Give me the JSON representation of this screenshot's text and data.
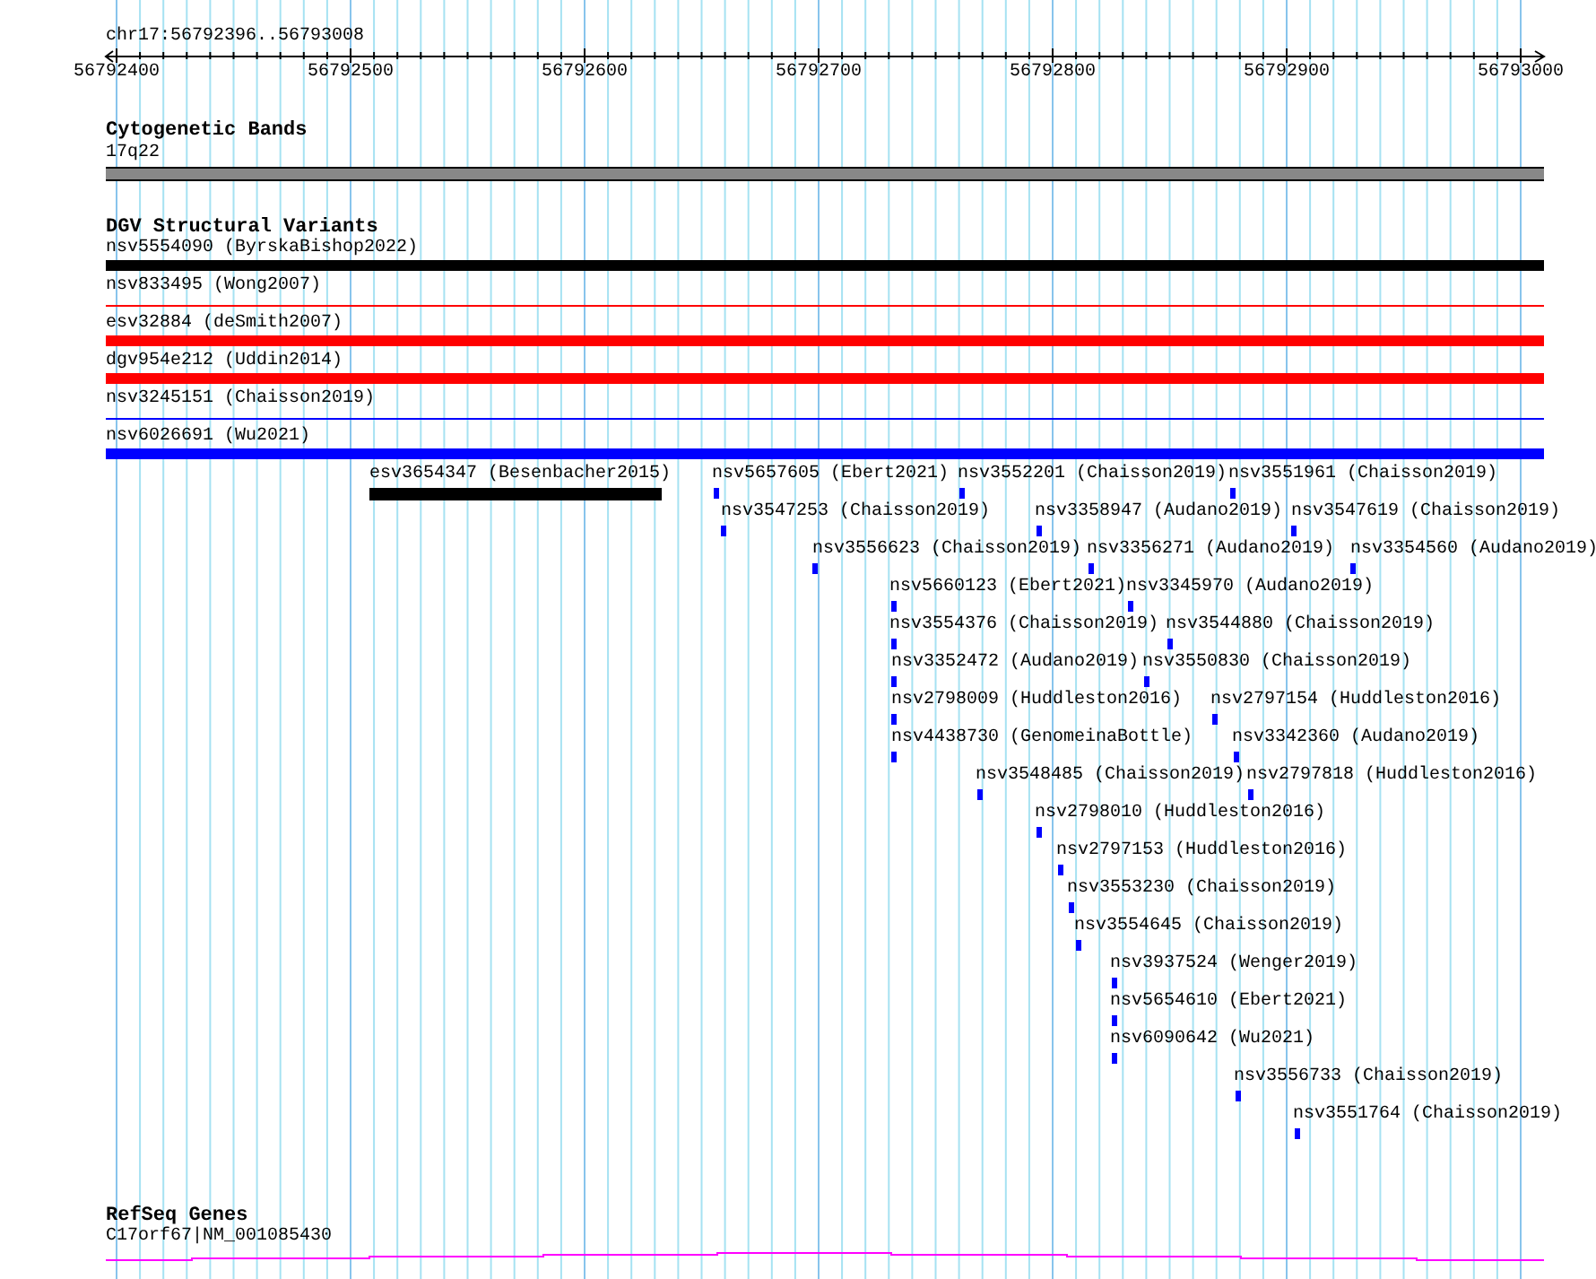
{
  "ruler": {
    "label": "chr17:56792396..56793008",
    "ticks": [
      "56792400",
      "56792500",
      "56792600",
      "56792700",
      "56792800",
      "56792900",
      "56793000"
    ]
  },
  "tracks": [
    {
      "kind": "bands",
      "title": "Cytogenetic Bands",
      "items": [
        {
          "label": "17q22"
        }
      ]
    },
    {
      "kind": "variants",
      "title": "DGV Structural Variants",
      "items": [
        {
          "label": "nsv5554090 (ByrskaBishop2022)",
          "color": "#000000",
          "kind": "thick"
        },
        {
          "label": "nsv833495 (Wong2007)",
          "color": "#ff0000",
          "kind": "thin"
        },
        {
          "label": "esv32884 (deSmith2007)",
          "color": "#ff0000",
          "kind": "thick"
        },
        {
          "label": "dgv954e212 (Uddin2014)",
          "color": "#ff0000",
          "kind": "thick"
        },
        {
          "label": "nsv3245151 (Chaisson2019)",
          "color": "#0000ff",
          "kind": "thin"
        },
        {
          "label": "nsv6026691 (Wu2021)",
          "color": "#0000ff",
          "kind": "thick"
        }
      ],
      "features": [
        {
          "label": "esv3654347 (Besenbacher2015)",
          "color": "#000000"
        },
        {
          "label": "nsv5657605 (Ebert2021)",
          "color": "#0000ff"
        },
        {
          "label": "nsv3552201 (Chaisson2019)",
          "color": "#0000ff"
        },
        {
          "label": "nsv3551961 (Chaisson2019)",
          "color": "#0000ff"
        },
        {
          "label": "nsv3547253 (Chaisson2019)",
          "color": "#0000ff"
        },
        {
          "label": "nsv3358947 (Audano2019)",
          "color": "#0000ff"
        },
        {
          "label": "nsv3547619 (Chaisson2019)",
          "color": "#0000ff"
        },
        {
          "label": "nsv3556623 (Chaisson2019)",
          "color": "#0000ff"
        },
        {
          "label": "nsv3356271 (Audano2019)",
          "color": "#0000ff"
        },
        {
          "label": "nsv3354560 (Audano2019)",
          "color": "#0000ff"
        },
        {
          "label": "nsv5660123 (Ebert2021)",
          "color": "#0000ff"
        },
        {
          "label": "nsv3345970 (Audano2019)",
          "color": "#0000ff"
        },
        {
          "label": "nsv3554376 (Chaisson2019)",
          "color": "#0000ff"
        },
        {
          "label": "nsv3544880 (Chaisson2019)",
          "color": "#0000ff"
        },
        {
          "label": "nsv3352472 (Audano2019)",
          "color": "#0000ff"
        },
        {
          "label": "nsv3550830 (Chaisson2019)",
          "color": "#0000ff"
        },
        {
          "label": "nsv2798009 (Huddleston2016)",
          "color": "#0000ff"
        },
        {
          "label": "nsv2797154 (Huddleston2016)",
          "color": "#0000ff"
        },
        {
          "label": "nsv4438730 (GenomeinaBottle)",
          "color": "#0000ff"
        },
        {
          "label": "nsv3342360 (Audano2019)",
          "color": "#0000ff"
        },
        {
          "label": "nsv3548485 (Chaisson2019)",
          "color": "#0000ff"
        },
        {
          "label": "nsv2797818 (Huddleston2016)",
          "color": "#0000ff"
        },
        {
          "label": "nsv2798010 (Huddleston2016)",
          "color": "#0000ff"
        },
        {
          "label": "nsv2797153 (Huddleston2016)",
          "color": "#0000ff"
        },
        {
          "label": "nsv3553230 (Chaisson2019)",
          "color": "#0000ff"
        },
        {
          "label": "nsv3554645 (Chaisson2019)",
          "color": "#0000ff"
        },
        {
          "label": "nsv3937524 (Wenger2019)",
          "color": "#0000ff"
        },
        {
          "label": "nsv5654610 (Ebert2021)",
          "color": "#0000ff"
        },
        {
          "label": "nsv6090642 (Wu2021)",
          "color": "#0000ff"
        },
        {
          "label": "nsv3556733 (Chaisson2019)",
          "color": "#0000ff"
        },
        {
          "label": "nsv3551764 (Chaisson2019)",
          "color": "#0000ff"
        }
      ]
    },
    {
      "kind": "genes",
      "title": "RefSeq Genes",
      "items": [
        {
          "label": "C17orf67|NM_001085430"
        }
      ]
    }
  ]
}
